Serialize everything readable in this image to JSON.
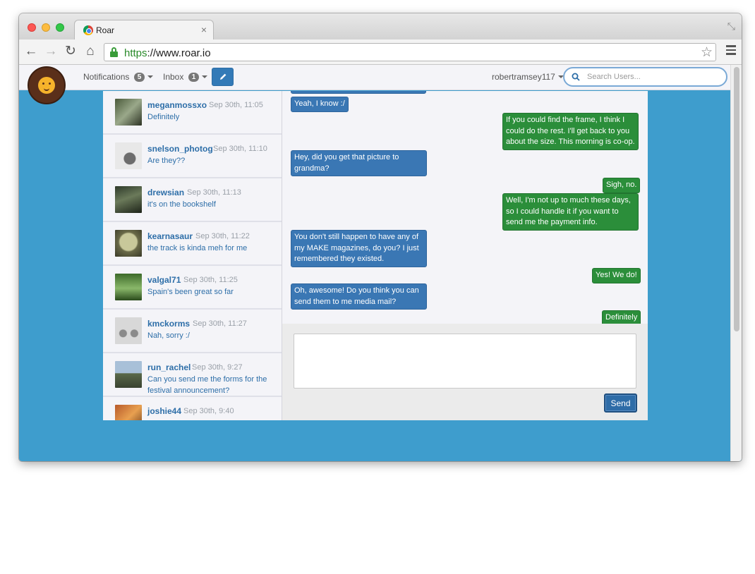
{
  "browser": {
    "tab_title": "Roar",
    "url_scheme": "https",
    "url_rest": "://www.roar.io"
  },
  "navbar": {
    "notifications_label": "Notifications",
    "notifications_count": "5",
    "inbox_label": "Inbox",
    "inbox_count": "1",
    "username": "robertramsey117",
    "search_placeholder": "Search Users..."
  },
  "conversations": [
    {
      "name": "meganmossxo",
      "time": "Sep 30th, 11:05",
      "preview": "Definitely"
    },
    {
      "name": "snelson_photog",
      "time": "Sep 30th, 11:10",
      "preview": "Are they??"
    },
    {
      "name": "drewsian",
      "time": "Sep 30th, 11:13",
      "preview": "it's on the bookshelf"
    },
    {
      "name": "kearnasaur",
      "time": "Sep 30th, 11:22",
      "preview": "the track is kinda meh for me"
    },
    {
      "name": "valgal71",
      "time": "Sep 30th, 11:25",
      "preview": "Spain's been great so far"
    },
    {
      "name": "kmckorms",
      "time": "Sep 30th, 11:27",
      "preview": "Nah, sorry :/"
    },
    {
      "name": "run_rachel",
      "time": "Sep 30th, 9:27",
      "preview": "Can you send me the forms for the festival announcement?"
    },
    {
      "name": "joshie44",
      "time": "Sep 30th, 9:40",
      "preview": ""
    }
  ],
  "messages": [
    {
      "from": "them",
      "text": "Yeah, I know :/"
    },
    {
      "from": "me",
      "text": "If you could find the frame, I think I could do the rest. I'll get back to you about the size. This morning is co-op."
    },
    {
      "from": "them",
      "text": "Hey, did you get that picture to grandma?"
    },
    {
      "from": "me",
      "text": "Sigh, no."
    },
    {
      "from": "me",
      "text": "Well, I'm not up to much these days, so I could handle it if you want to send me the payment info."
    },
    {
      "from": "them",
      "text": "You don't still happen to have any of my MAKE magazines, do you? I just remembered they existed."
    },
    {
      "from": "me",
      "text": "Yes! We do!"
    },
    {
      "from": "them",
      "text": "Oh, awesome! Do you think you can send them to me media mail?"
    },
    {
      "from": "me",
      "text": "Definitely"
    }
  ],
  "composer": {
    "reply_value": "",
    "send_label": "Send"
  }
}
